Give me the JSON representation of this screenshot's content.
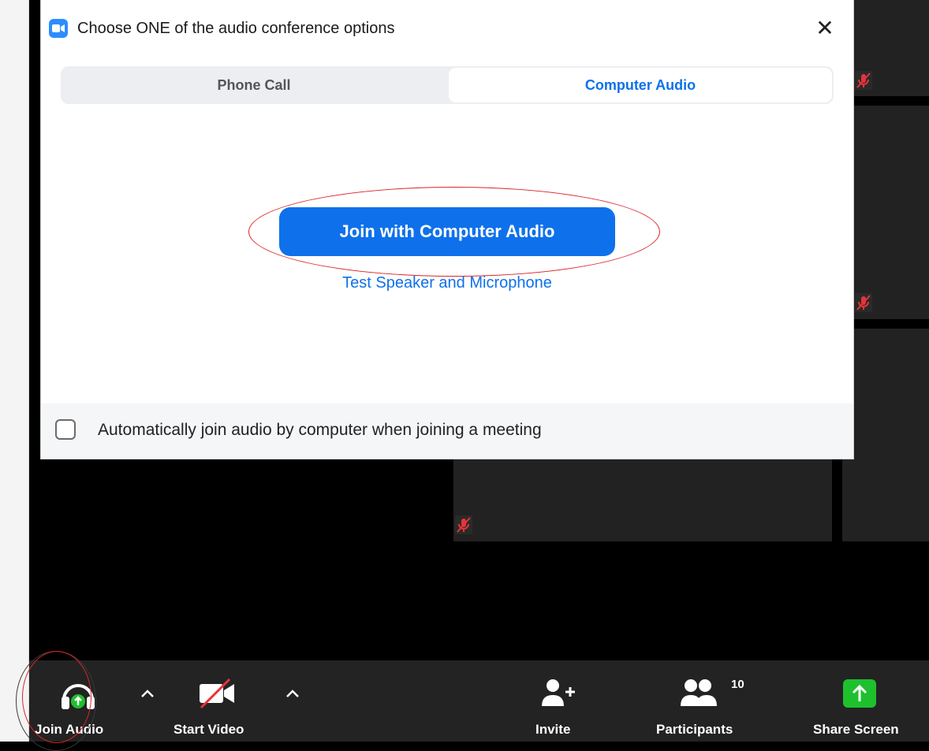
{
  "dialog": {
    "title": "Choose ONE of the audio conference options",
    "close_symbol": "✕",
    "tabs": [
      {
        "label": "Phone Call",
        "selected": false
      },
      {
        "label": "Computer Audio",
        "selected": true
      }
    ],
    "primary_button": "Join with Computer Audio",
    "test_link": "Test Speaker and Microphone",
    "auto_join_checkbox": {
      "label": "Automatically join audio by computer when joining a meeting",
      "checked": false
    }
  },
  "toolbar": {
    "join_audio": "Join Audio",
    "start_video": "Start Video",
    "invite": "Invite",
    "participants": "Participants",
    "participants_count": "10",
    "share_screen": "Share Screen"
  },
  "colors": {
    "accent_blue": "#0e71eb",
    "share_green": "#1ec02e",
    "annotation_red": "#d9252b",
    "toolbar_bg": "#232323"
  },
  "icons": [
    "app-logo-icon",
    "close-icon",
    "headphones-icon",
    "video-off-icon",
    "caret-up-icon",
    "add-person-icon",
    "participants-icon",
    "share-screen-icon",
    "muted-mic-icon"
  ]
}
